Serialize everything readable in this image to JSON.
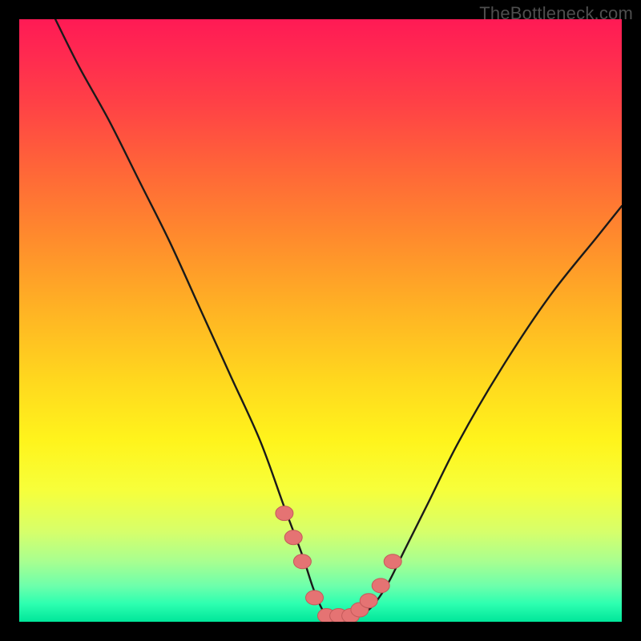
{
  "watermark": {
    "text": "TheBottleneck.com"
  },
  "colors": {
    "page_bg": "#000000",
    "curve_stroke": "#1a1a1a",
    "marker_fill": "#e57373",
    "marker_stroke": "#c45a5a",
    "gradient_stops": [
      "#ff1a55",
      "#ff2a50",
      "#ff4146",
      "#ff6638",
      "#ff8a2d",
      "#ffb224",
      "#ffd81e",
      "#fff41c",
      "#f7ff3a",
      "#d7ff6a",
      "#a8ff90",
      "#6effab",
      "#2dffb0",
      "#00e69a"
    ]
  },
  "chart_data": {
    "type": "line",
    "title": "",
    "xlabel": "",
    "ylabel": "",
    "xlim": [
      0,
      100
    ],
    "ylim": [
      0,
      100
    ],
    "grid": false,
    "legend": false,
    "series": [
      {
        "name": "bottleneck-curve",
        "x": [
          6,
          10,
          15,
          20,
          25,
          30,
          35,
          40,
          44,
          47,
          49,
          51,
          53,
          55,
          58,
          61,
          64,
          68,
          73,
          80,
          88,
          96,
          100
        ],
        "values": [
          100,
          92,
          83,
          73,
          63,
          52,
          41,
          30,
          19,
          11,
          5,
          1,
          1,
          1,
          2,
          6,
          12,
          20,
          30,
          42,
          54,
          64,
          69
        ]
      }
    ],
    "markers": {
      "name": "highlight-points",
      "x": [
        44.0,
        45.5,
        47.0,
        49.0,
        51.0,
        53.0,
        55.0,
        56.5,
        58.0,
        60.0,
        62.0
      ],
      "values": [
        18.0,
        14.0,
        10.0,
        4.0,
        1.0,
        1.0,
        1.0,
        2.0,
        3.5,
        6.0,
        10.0
      ]
    }
  }
}
